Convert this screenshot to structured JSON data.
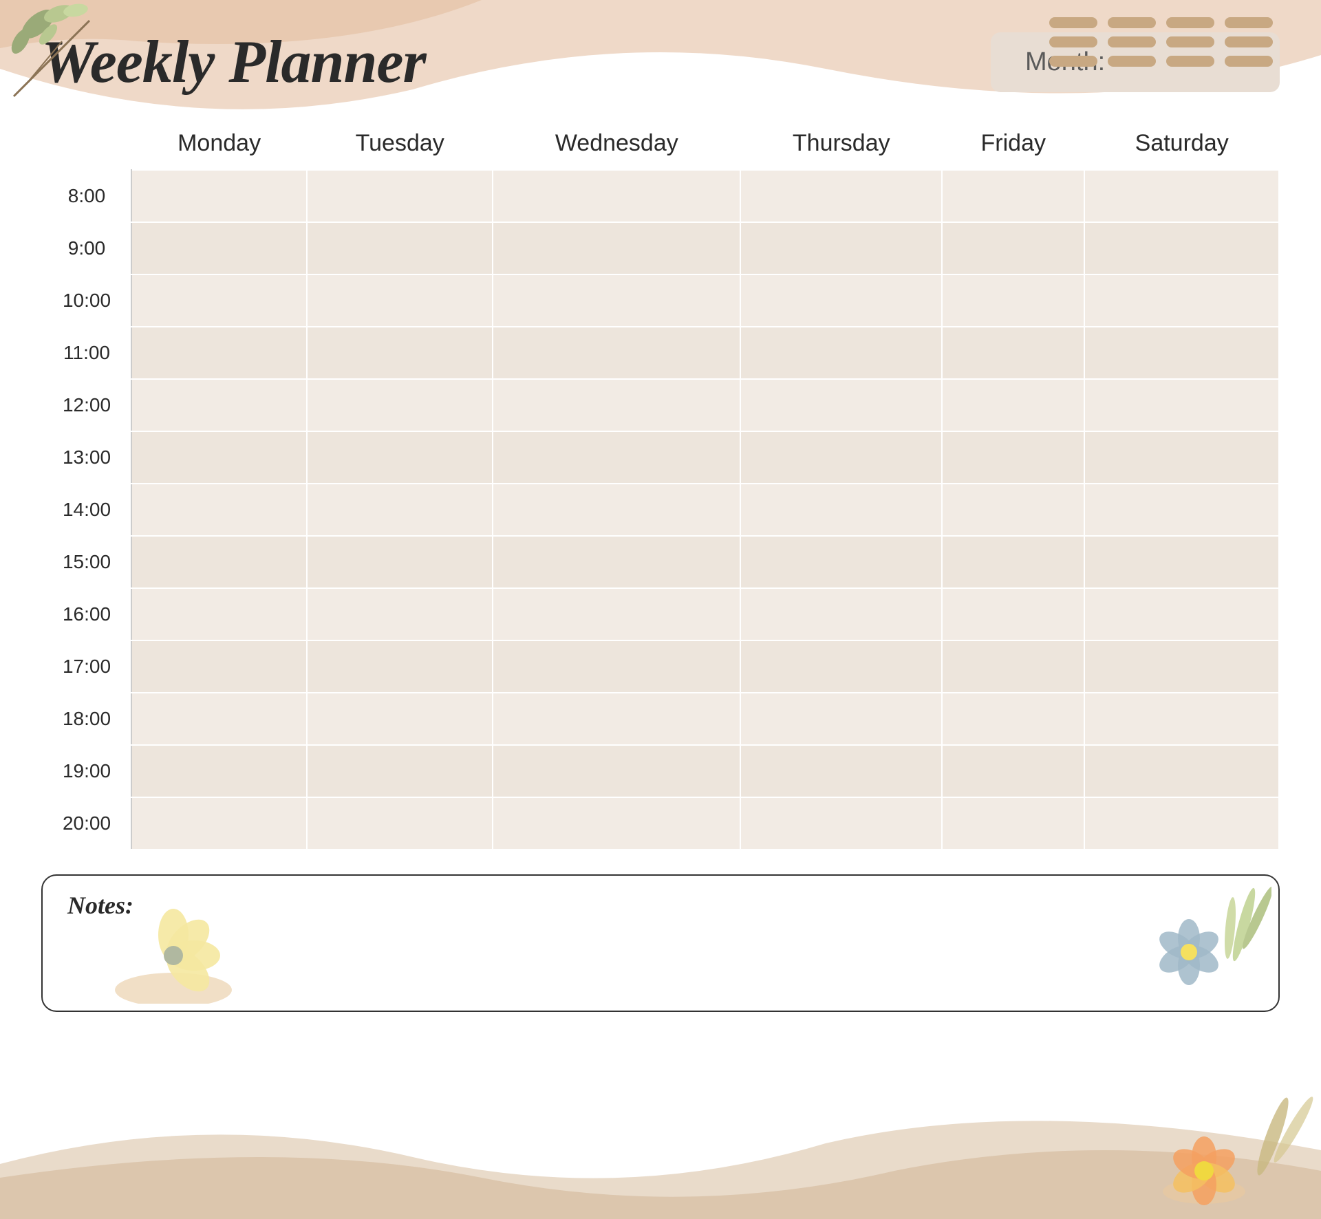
{
  "title": "Weekly Planner",
  "month_label": "Month:",
  "days": [
    "Monday",
    "Tuesday",
    "Wednesday",
    "Thursday",
    "Friday",
    "Saturday"
  ],
  "times": [
    "8:00",
    "9:00",
    "10:00",
    "11:00",
    "12:00",
    "13:00",
    "14:00",
    "15:00",
    "16:00",
    "17:00",
    "18:00",
    "19:00",
    "20:00"
  ],
  "notes_label": "Notes:",
  "colors": {
    "background": "#ffffff",
    "wave_top": "#e8c9b0",
    "cell_odd": "#f2ebe4",
    "cell_even": "#ede5dc",
    "month_box": "#e8ddd3",
    "title": "#2a2a2a",
    "dashes": "#c8a882"
  }
}
